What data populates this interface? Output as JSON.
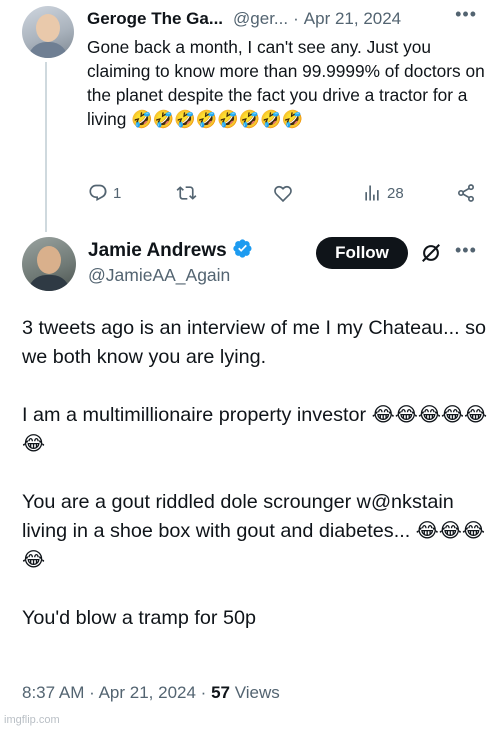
{
  "reply_tweet": {
    "author_name": "Geroge The Ga...",
    "handle": "@ger...",
    "separator": "·",
    "date": "Apr 21, 2024",
    "more_icon": "more-horizontal-icon",
    "text": "Gone back a month, I can't see any. Just you claiming to know more than 99.9999% of doctors on the planet despite the fact you drive a tractor for a living 🤣🤣🤣🤣🤣🤣🤣🤣",
    "actions": {
      "reply_count": "1",
      "retweet_count": "",
      "like_count": "",
      "views_count": "28"
    }
  },
  "main_tweet": {
    "author_name": "Jamie Andrews",
    "verified_icon": "verified-badge-icon",
    "handle": "@JamieAA_Again",
    "follow_label": "Follow",
    "paragraphs": [
      "3 tweets ago is an interview of me I  my Chateau... so we both know you are lying.",
      "I am a multimillionaire property investor 😂😂😂😂😂😂",
      "You are a gout riddled dole scrounger w@nkstain living in a shoe box with gout and diabetes...  😂😂😂😂",
      "You'd blow a tramp for 50p"
    ],
    "time": "8:37 AM",
    "separator": "·",
    "date": "Apr 21, 2024",
    "separator2": "·",
    "views_count": "57",
    "views_label": "Views"
  },
  "watermark": "imgflip.com",
  "colors": {
    "text": "#0f1419",
    "secondary": "#536471",
    "verified": "#1d9bf0",
    "follow_bg": "#0f1419",
    "thread_line": "#cfd9de"
  }
}
